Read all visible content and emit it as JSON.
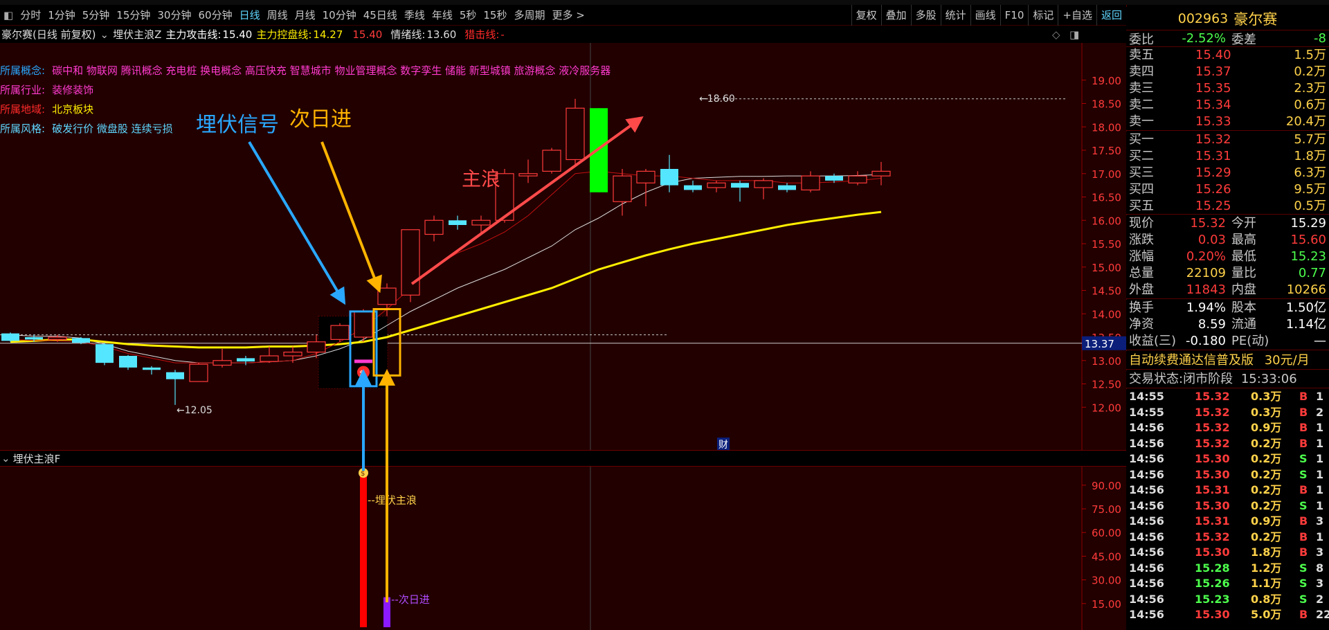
{
  "toolbar": {
    "periods": [
      "分时",
      "1分钟",
      "5分钟",
      "15分钟",
      "30分钟",
      "60分钟",
      "日线",
      "周线",
      "月线",
      "10分钟",
      "45日线",
      "季线",
      "年线",
      "5秒",
      "15秒",
      "多周期",
      "更多 >"
    ],
    "active_period": "日线",
    "right_buttons": [
      "复权",
      "叠加",
      "多股",
      "统计",
      "画线",
      "F10",
      "标记",
      "+自选",
      "返回"
    ]
  },
  "chart_header": {
    "title": "豪尔赛(日线 前复权)",
    "indicator": "埋伏主浪Z",
    "attack_label": "主力攻击线:",
    "attack_value": "15.40",
    "control_label": "主力控盘线:",
    "control_value": "14.27",
    "extra_value": "15.40",
    "mood_label": "情绪线:",
    "mood_value": "13.60",
    "strike_label": "猎击线:",
    "strike_value": "-"
  },
  "concepts": {
    "concept_label": "所属概念:",
    "concept_value": "碳中和 物联网 腾讯概念 充电桩 换电概念 高压快充 智慧城市 物业管理概念 数字孪生 储能 新型城镇 旅游概念 液冷服务器",
    "industry_label": "所属行业:",
    "industry_value": "装修装饰",
    "region_label": "所属地域:",
    "region_value": "北京板块",
    "style_label": "所属风格:",
    "style_value": "破发行价 微盘股 连续亏损"
  },
  "annotations": {
    "signal": "埋伏信号",
    "next_day": "次日进",
    "main_wave": "主浪",
    "high_label": "18.60",
    "low_label": "12.05",
    "fin_mark": "财",
    "crosshair_price": "13.37",
    "sub_signal_label": "埋伏主浪",
    "sub_next_label": "次日进"
  },
  "sub_header": {
    "title": "埋伏主浪F"
  },
  "chart_data": [
    {
      "type": "candlestick",
      "title": "豪尔赛(日线 前复权)",
      "y_ticks": [
        "19.00",
        "18.50",
        "18.00",
        "17.50",
        "17.00",
        "16.50",
        "16.00",
        "15.50",
        "15.00",
        "14.50",
        "14.00",
        "13.50",
        "13.00",
        "12.50",
        "12.00"
      ],
      "ylim": [
        11.5,
        19.5
      ],
      "candles": [
        {
          "o": 13.58,
          "h": 13.6,
          "l": 13.4,
          "c": 13.42
        },
        {
          "o": 13.5,
          "h": 13.55,
          "l": 13.4,
          "c": 13.45
        },
        {
          "o": 13.45,
          "h": 13.55,
          "l": 13.4,
          "c": 13.5
        },
        {
          "o": 13.48,
          "h": 13.5,
          "l": 13.35,
          "c": 13.38
        },
        {
          "o": 13.35,
          "h": 13.38,
          "l": 12.9,
          "c": 12.95
        },
        {
          "o": 13.1,
          "h": 13.12,
          "l": 12.8,
          "c": 12.85
        },
        {
          "o": 12.85,
          "h": 12.88,
          "l": 12.7,
          "c": 12.8
        },
        {
          "o": 12.75,
          "h": 12.8,
          "l": 12.05,
          "c": 12.6
        },
        {
          "o": 12.55,
          "h": 12.95,
          "l": 12.55,
          "c": 12.92
        },
        {
          "o": 12.9,
          "h": 13.25,
          "l": 12.85,
          "c": 13.0
        },
        {
          "o": 13.05,
          "h": 13.1,
          "l": 12.9,
          "c": 12.98
        },
        {
          "o": 12.98,
          "h": 13.3,
          "l": 12.95,
          "c": 13.1
        },
        {
          "o": 13.1,
          "h": 13.3,
          "l": 12.95,
          "c": 13.18
        },
        {
          "o": 13.18,
          "h": 13.55,
          "l": 13.05,
          "c": 13.4
        },
        {
          "o": 13.45,
          "h": 13.8,
          "l": 13.4,
          "c": 13.75
        },
        {
          "o": 13.5,
          "h": 14.1,
          "l": 13.4,
          "c": 14.05
        },
        {
          "o": 14.2,
          "h": 14.65,
          "l": 13.95,
          "c": 14.55
        },
        {
          "o": 14.4,
          "h": 15.7,
          "l": 14.25,
          "c": 15.8
        },
        {
          "o": 15.7,
          "h": 16.1,
          "l": 15.55,
          "c": 16.0
        },
        {
          "o": 16.0,
          "h": 16.1,
          "l": 15.8,
          "c": 15.9
        },
        {
          "o": 15.9,
          "h": 16.1,
          "l": 15.7,
          "c": 16.0
        },
        {
          "o": 16.0,
          "h": 17.1,
          "l": 15.95,
          "c": 17.0
        },
        {
          "o": 16.95,
          "h": 17.3,
          "l": 16.8,
          "c": 17.0
        },
        {
          "o": 17.05,
          "h": 17.55,
          "l": 17.0,
          "c": 17.5
        },
        {
          "o": 17.3,
          "h": 18.6,
          "l": 17.2,
          "c": 18.4
        },
        {
          "o": 18.4,
          "h": 18.4,
          "l": 16.6,
          "c": 16.6
        },
        {
          "o": 16.4,
          "h": 17.1,
          "l": 16.1,
          "c": 16.95
        },
        {
          "o": 16.8,
          "h": 17.1,
          "l": 16.3,
          "c": 17.05
        },
        {
          "o": 17.1,
          "h": 17.4,
          "l": 16.6,
          "c": 16.75
        },
        {
          "o": 16.75,
          "h": 16.85,
          "l": 16.6,
          "c": 16.65
        },
        {
          "o": 16.7,
          "h": 16.85,
          "l": 16.6,
          "c": 16.8
        },
        {
          "o": 16.8,
          "h": 16.85,
          "l": 16.4,
          "c": 16.7
        },
        {
          "o": 16.7,
          "h": 16.9,
          "l": 16.45,
          "c": 16.85
        },
        {
          "o": 16.75,
          "h": 16.8,
          "l": 16.6,
          "c": 16.65
        },
        {
          "o": 16.65,
          "h": 17.05,
          "l": 16.6,
          "c": 16.95
        },
        {
          "o": 16.95,
          "h": 17.0,
          "l": 16.8,
          "c": 16.85
        },
        {
          "o": 16.8,
          "h": 17.05,
          "l": 16.75,
          "c": 16.95
        },
        {
          "o": 16.95,
          "h": 17.25,
          "l": 16.75,
          "c": 17.05
        }
      ],
      "series": [
        {
          "values": [
            13.55,
            13.52,
            13.52,
            13.48,
            13.35,
            13.2,
            13.1,
            13.0,
            12.95,
            12.95,
            12.95,
            12.97,
            13.0,
            13.1,
            13.25,
            13.45,
            13.75,
            14.05,
            14.3,
            14.55,
            14.75,
            14.95,
            15.2,
            15.45,
            15.8,
            16.05,
            16.35,
            16.6,
            16.8,
            16.9,
            16.92,
            16.94,
            16.94,
            16.95,
            16.95,
            16.95,
            16.96,
            16.98
          ]
        },
        {
          "values": [
            13.4,
            13.42,
            13.45,
            13.45,
            13.4,
            13.35,
            13.32,
            13.3,
            13.28,
            13.28,
            13.28,
            13.3,
            13.3,
            13.32,
            13.35,
            13.4,
            13.5,
            13.65,
            13.8,
            13.95,
            14.1,
            14.25,
            14.4,
            14.55,
            14.75,
            14.95,
            15.1,
            15.25,
            15.38,
            15.5,
            15.6,
            15.7,
            15.8,
            15.9,
            15.98,
            16.05,
            16.12,
            16.18
          ]
        },
        {
          "values": [
            13.45,
            13.43,
            13.42,
            13.4,
            13.3,
            13.15,
            13.05,
            12.95,
            12.95,
            12.95,
            12.95,
            12.97,
            13.0,
            13.15,
            13.4,
            13.7,
            14.1,
            14.55,
            15.0,
            15.3,
            15.5,
            15.75,
            16.1,
            16.55,
            17.0,
            17.05,
            17.0,
            16.95,
            16.95,
            16.9,
            16.85,
            16.85,
            16.85,
            16.8,
            16.8,
            16.82,
            16.85,
            16.9
          ]
        }
      ]
    },
    {
      "type": "bar",
      "title": "埋伏主浪F",
      "y_ticks": [
        "90.00",
        "75.00",
        "60.00",
        "45.00",
        "30.00",
        "15.00"
      ],
      "ylim": [
        0,
        100
      ],
      "bars": [
        {
          "name": "埋伏主浪",
          "value": 96
        },
        {
          "name": "次日进",
          "value": 19
        }
      ]
    }
  ],
  "quote_panel": {
    "code": "002963",
    "name": "豪尔赛",
    "weibi_label": "委比",
    "weibi_value": "-2.52%",
    "weicha_label": "委差",
    "weicha_value": "-8",
    "asks": [
      {
        "label": "卖五",
        "price": "15.40",
        "vol": "1.5万"
      },
      {
        "label": "卖四",
        "price": "15.37",
        "vol": "0.2万"
      },
      {
        "label": "卖三",
        "price": "15.35",
        "vol": "2.3万"
      },
      {
        "label": "卖二",
        "price": "15.34",
        "vol": "0.6万"
      },
      {
        "label": "卖一",
        "price": "15.33",
        "vol": "20.4万"
      }
    ],
    "bids": [
      {
        "label": "买一",
        "price": "15.32",
        "vol": "5.7万"
      },
      {
        "label": "买二",
        "price": "15.31",
        "vol": "1.8万"
      },
      {
        "label": "买三",
        "price": "15.29",
        "vol": "6.3万"
      },
      {
        "label": "买四",
        "price": "15.26",
        "vol": "9.5万"
      },
      {
        "label": "买五",
        "price": "15.25",
        "vol": "0.5万"
      }
    ],
    "stats": [
      {
        "l1": "现价",
        "v1": "15.32",
        "l2": "今开",
        "v2": "15.29"
      },
      {
        "l1": "涨跌",
        "v1": "0.03",
        "l2": "最高",
        "v2": "15.60"
      },
      {
        "l1": "涨幅",
        "v1": "0.20%",
        "l2": "最低",
        "v2": "15.23"
      },
      {
        "l1": "总量",
        "v1": "22109",
        "l2": "量比",
        "v2": "0.77"
      },
      {
        "l1": "外盘",
        "v1": "11843",
        "l2": "内盘",
        "v2": "10266"
      }
    ],
    "stats2": [
      {
        "l1": "换手",
        "v1": "1.94%",
        "l2": "股本",
        "v2": "1.50亿"
      },
      {
        "l1": "净资",
        "v1": "8.59",
        "l2": "流通",
        "v2": "1.14亿"
      },
      {
        "l1": "收益(三)",
        "v1": "-0.180",
        "l2": "PE(动)",
        "v2": "—"
      }
    ],
    "ad_text": "自动续费通达信普及版",
    "ad_price": "30元/月",
    "state_label": "交易状态:",
    "state_value": "闭市阶段",
    "state_time": "15:33:06",
    "ticks": [
      {
        "t": "14:55",
        "p": "15.32",
        "v": "0.3万",
        "d": "B",
        "c": "1"
      },
      {
        "t": "14:55",
        "p": "15.32",
        "v": "0.3万",
        "d": "B",
        "c": "2"
      },
      {
        "t": "14:56",
        "p": "15.32",
        "v": "0.9万",
        "d": "B",
        "c": "1"
      },
      {
        "t": "14:56",
        "p": "15.32",
        "v": "0.2万",
        "d": "B",
        "c": "1"
      },
      {
        "t": "14:56",
        "p": "15.30",
        "v": "0.2万",
        "d": "S",
        "c": "1"
      },
      {
        "t": "14:56",
        "p": "15.30",
        "v": "0.2万",
        "d": "S",
        "c": "1"
      },
      {
        "t": "14:56",
        "p": "15.31",
        "v": "0.2万",
        "d": "B",
        "c": "1"
      },
      {
        "t": "14:56",
        "p": "15.30",
        "v": "0.2万",
        "d": "S",
        "c": "1"
      },
      {
        "t": "14:56",
        "p": "15.31",
        "v": "0.9万",
        "d": "B",
        "c": "3"
      },
      {
        "t": "14:56",
        "p": "15.32",
        "v": "0.2万",
        "d": "B",
        "c": "1"
      },
      {
        "t": "14:56",
        "p": "15.30",
        "v": "1.8万",
        "d": "B",
        "c": "3"
      },
      {
        "t": "14:56",
        "p": "15.28",
        "v": "1.2万",
        "d": "S",
        "c": "8"
      },
      {
        "t": "14:56",
        "p": "15.26",
        "v": "1.1万",
        "d": "S",
        "c": "3"
      },
      {
        "t": "14:56",
        "p": "15.23",
        "v": "0.8万",
        "d": "S",
        "c": "2"
      },
      {
        "t": "14:56",
        "p": "15.30",
        "v": "5.0万",
        "d": "B",
        "c": "22"
      }
    ]
  },
  "colors": {
    "up": "#ff3b3b",
    "down": "#55e6ff",
    "ma_yellow": "#ffee00",
    "ma_red": "#c01010",
    "ma_white": "#dddddd",
    "signal_blue": "#2aa8ff",
    "next_orange": "#ffb400",
    "arrow_red": "#ff4a4a",
    "bar_red": "#ff0000",
    "bar_purple": "#8c1aff",
    "big_green": "#00ff00",
    "link_blue": "#5fd7ff",
    "pink": "#ff3bd0",
    "yellow": "#ffd24a"
  },
  "icons": [
    "window-icon",
    "collapse-arrow-icon",
    "diamond-icon",
    "panel-toggle-icon",
    "money-bag-icon",
    "buy-signal-icon"
  ]
}
